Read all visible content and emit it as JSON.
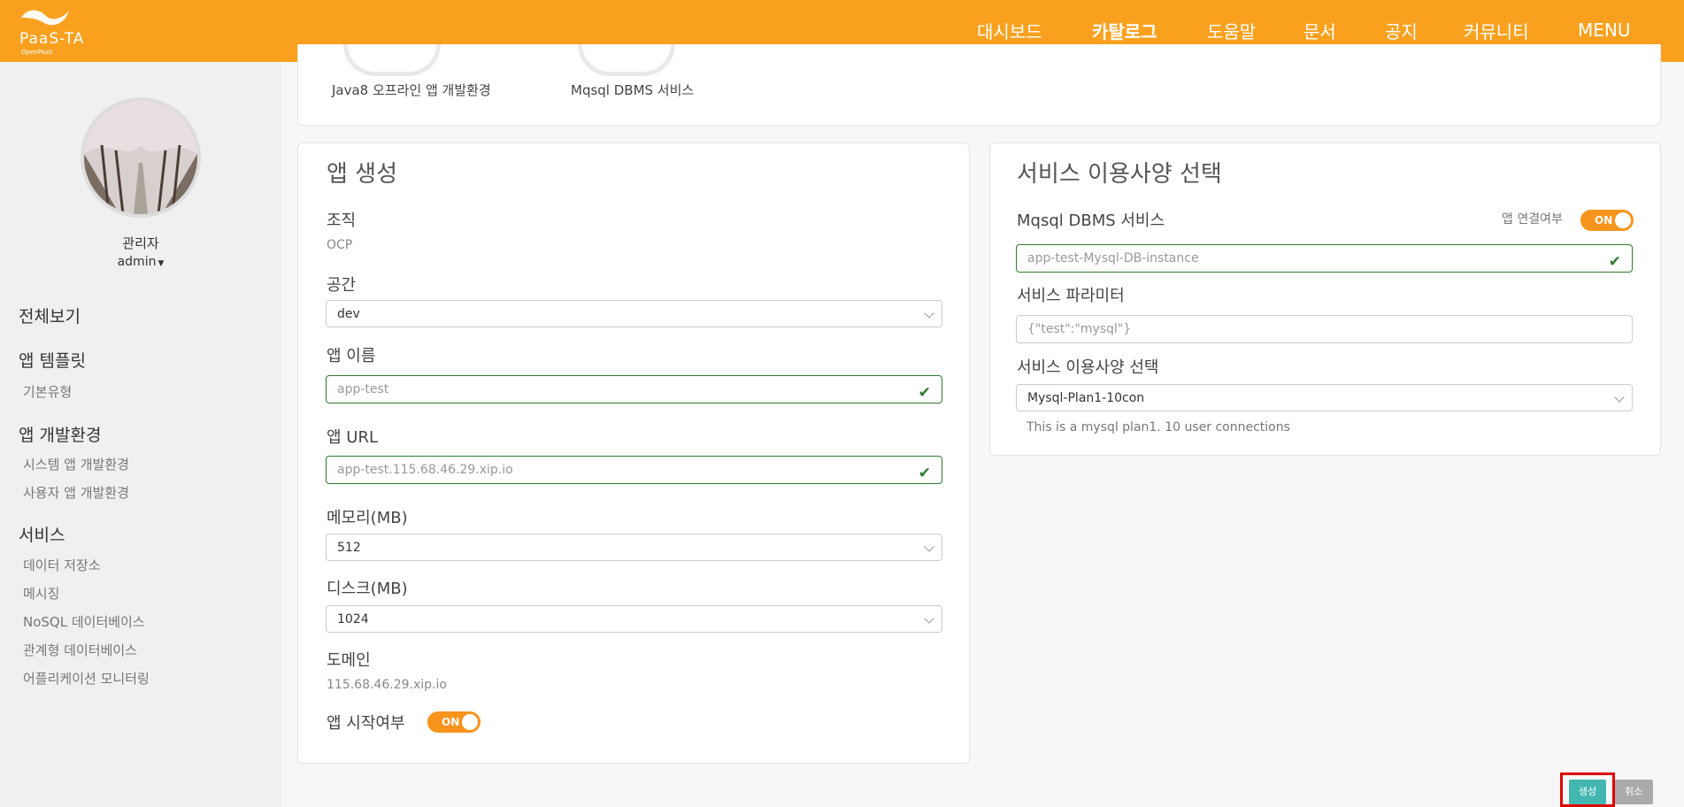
{
  "brand": {
    "name": "PaaS-TA",
    "sub": "OpenPaaS"
  },
  "nav": [
    {
      "label": "대시보드",
      "active": false
    },
    {
      "label": "카탈로그",
      "active": true
    },
    {
      "label": "도움말",
      "active": false
    },
    {
      "label": "문서",
      "active": false
    },
    {
      "label": "공지",
      "active": false
    },
    {
      "label": "커뮤니티",
      "active": false
    },
    {
      "label": "MENU",
      "active": false
    }
  ],
  "profile": {
    "name": "관리자",
    "id": "admin"
  },
  "sidebar": {
    "all": "전체보기",
    "templates": {
      "title": "앱 템플릿",
      "items": [
        "기본유형"
      ]
    },
    "devenv": {
      "title": "앱 개발환경",
      "items": [
        "시스템 앱 개발환경",
        "사용자 앱 개발환경"
      ]
    },
    "services": {
      "title": "서비스",
      "items": [
        "데이터 저장소",
        "메시징",
        "NoSQL 데이터베이스",
        "관계형 데이터베이스",
        "어플리케이션 모니터링"
      ]
    }
  },
  "templates": [
    "Java8 오프라인 앱 개발환경",
    "Mqsql DBMS 서비스"
  ],
  "app_form": {
    "title": "앱 생성",
    "org_label": "조직",
    "org_value": "OCP",
    "space_label": "공간",
    "space_value": "dev",
    "name_label": "앱 이름",
    "name_value": "app-test",
    "url_label": "앱 URL",
    "url_value": "app-test.115.68.46.29.xip.io",
    "memory_label": "메모리(MB)",
    "memory_value": "512",
    "disk_label": "디스크(MB)",
    "disk_value": "1024",
    "domain_label": "도메인",
    "domain_value": "115.68.46.29.xip.io",
    "start_label": "앱 시작여부",
    "start_toggle": "ON"
  },
  "service_form": {
    "title": "서비스 이용사양 선택",
    "service_name": "Mqsql DBMS 서비스",
    "bind_label": "앱 연결여부",
    "bind_toggle": "ON",
    "instance_value": "app-test-Mysql-DB-instance",
    "param_label": "서비스 파라미터",
    "param_value": "{\"test\":\"mysql\"}",
    "plan_label": "서비스 이용사양 선택",
    "plan_value": "Mysql-Plan1-10con",
    "plan_desc": "This is a mysql plan1. 10 user connections"
  },
  "buttons": {
    "create": "생성",
    "cancel": "취소"
  },
  "colors": {
    "topbar": "#f9a11f",
    "toggle": "#f7941d",
    "valid": "#2f7a2f",
    "create": "#44b6b1",
    "highlight": "#e00000"
  }
}
